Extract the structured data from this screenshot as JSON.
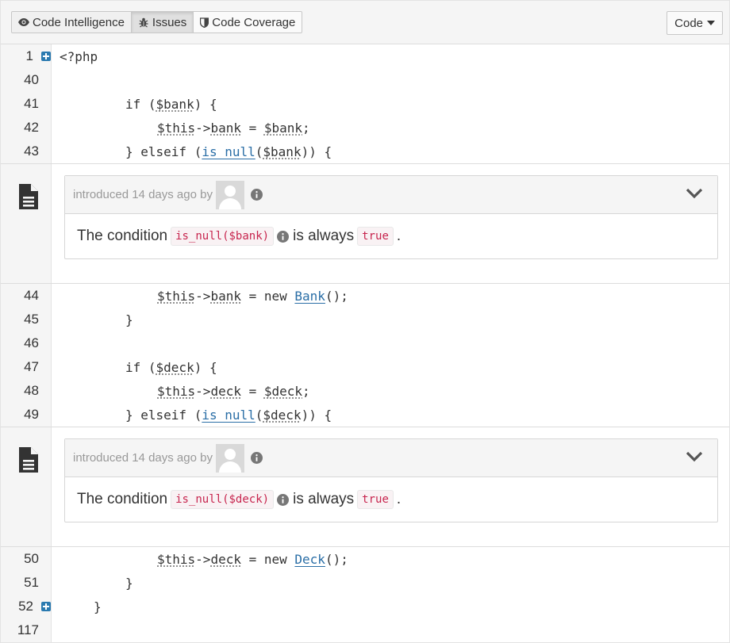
{
  "toolbar": {
    "tabs": [
      {
        "label": "Code Intelligence",
        "icon": "eye-icon"
      },
      {
        "label": "Issues",
        "icon": "bug-icon"
      },
      {
        "label": "Code Coverage",
        "icon": "shield-icon"
      }
    ],
    "code_dropdown": "Code"
  },
  "code_lines_a": [
    {
      "num": "1",
      "text": "<?php"
    },
    {
      "num": "40",
      "text": ""
    },
    {
      "num": "41",
      "text": "if ($bank) {"
    },
    {
      "num": "42",
      "text": "$this->bank = $bank;"
    },
    {
      "num": "43",
      "text": "} elseif (is_null($bank)) {"
    }
  ],
  "issue1": {
    "meta": "introduced 14 days ago by",
    "prefix": "The condition",
    "expr": "is_null($bank)",
    "middle": "is always",
    "value": "true",
    "suffix": "."
  },
  "code_lines_b": [
    {
      "num": "44",
      "text": "$this->bank = new Bank();"
    },
    {
      "num": "45",
      "text": "}"
    },
    {
      "num": "46",
      "text": ""
    },
    {
      "num": "47",
      "text": "if ($deck) {"
    },
    {
      "num": "48",
      "text": "$this->deck = $deck;"
    },
    {
      "num": "49",
      "text": "} elseif (is_null($deck)) {"
    }
  ],
  "issue2": {
    "meta": "introduced 14 days ago by",
    "prefix": "The condition",
    "expr": "is_null($deck)",
    "middle": "is always",
    "value": "true",
    "suffix": "."
  },
  "code_lines_c": [
    {
      "num": "50",
      "text": "$this->deck = new Deck();"
    },
    {
      "num": "51",
      "text": "}"
    },
    {
      "num": "52",
      "text": "}"
    },
    {
      "num": "117",
      "text": ""
    }
  ],
  "colors": {
    "link": "#2a6ea6",
    "chip_text": "#c7254e",
    "gutter_bg": "#f5f5f5",
    "fold_icon": "#2a7ab0"
  }
}
